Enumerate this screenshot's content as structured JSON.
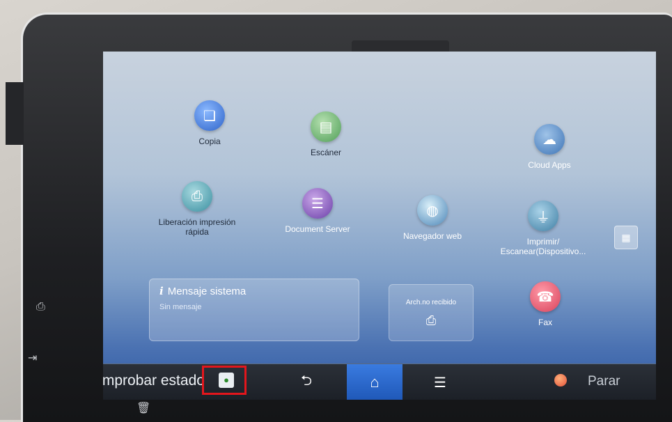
{
  "apps": {
    "copia": {
      "label": "Copia",
      "icon": "copy-icon"
    },
    "escaner": {
      "label": "Escáner",
      "icon": "scanner-icon"
    },
    "cloud": {
      "label": "Cloud Apps",
      "icon": "cloud-icon"
    },
    "liberacion": {
      "label": "Liberación impresión rápida",
      "icon": "print-release-icon"
    },
    "docserver": {
      "label": "Document Server",
      "icon": "document-server-icon"
    },
    "navegador": {
      "label": "Navegador web",
      "icon": "globe-icon"
    },
    "imprimir": {
      "label": "Imprimir/ Escanear(Dispositivo...",
      "icon": "usb-icon"
    },
    "fax": {
      "label": "Fax",
      "icon": "fax-icon"
    }
  },
  "message_panel": {
    "title": "Mensaje sistema",
    "subtitle": "Sin mensaje"
  },
  "arch_panel": {
    "label": "Arch.no recibido"
  },
  "bottom_bar": {
    "status_label": "Comprobar estado",
    "stop_label": "Parar"
  },
  "colors": {
    "highlight": "#e3161c",
    "home_active": "#2a6ad0"
  }
}
